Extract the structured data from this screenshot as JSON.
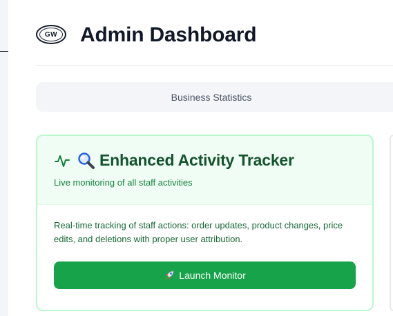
{
  "header": {
    "logo_text": "GW",
    "title": "Admin Dashboard"
  },
  "tabs": [
    {
      "label": "Business Statistics"
    }
  ],
  "activity_card": {
    "title": "Enhanced Activity Tracker",
    "subtitle": "Live monitoring of all staff activities",
    "description": "Real-time tracking of staff actions: order updates, product changes, price edits, and deletions with proper user attribution.",
    "button_label": "Launch Monitor",
    "icons": [
      "pulse-icon",
      "magnifier-icon",
      "rocket-icon"
    ]
  },
  "colors": {
    "accent": "#16a34a",
    "card_border": "#bbf7d0",
    "card_header_bg": "#f0fdf4",
    "title_text": "#14532d",
    "subtitle_text": "#15803d"
  }
}
